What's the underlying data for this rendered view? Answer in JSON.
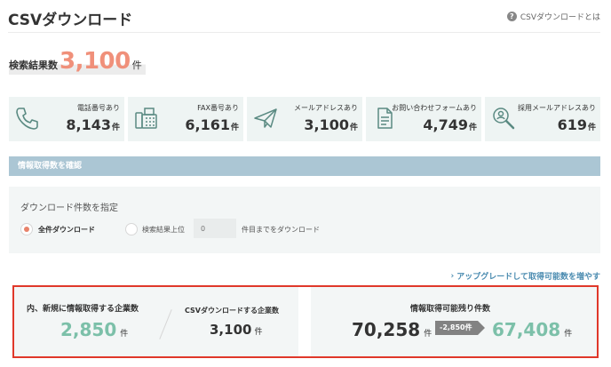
{
  "header": {
    "title": "CSVダウンロード",
    "help_icon": "?",
    "help_link": "CSVダウンロードとは"
  },
  "result": {
    "label": "検索結果数",
    "count": "3,100",
    "unit": "件"
  },
  "stats": [
    {
      "icon": "phone-icon",
      "label": "電話番号あり",
      "value": "8,143",
      "unit": "件"
    },
    {
      "icon": "fax-icon",
      "label": "FAX番号あり",
      "value": "6,161",
      "unit": "件"
    },
    {
      "icon": "paper-plane-icon",
      "label": "メールアドレスあり",
      "value": "3,100",
      "unit": "件"
    },
    {
      "icon": "document-icon",
      "label": "お問い合わせフォームあり",
      "value": "4,749",
      "unit": "件"
    },
    {
      "icon": "search-person-icon",
      "label": "採用メールアドレスあり",
      "value": "619",
      "unit": "件"
    }
  ],
  "section": {
    "title": "情報取得数を確認"
  },
  "download": {
    "title": "ダウンロード件数を指定",
    "option_all": "全件ダウンロード",
    "option_top_prefix": "検索結果上位",
    "top_placeholder": "0",
    "option_top_suffix": "件目までをダウンロード"
  },
  "upgrade": {
    "chevron": "›",
    "label": "アップグレードして取得可能数を増やす"
  },
  "summary": {
    "new_label": "内、新規に情報取得する企業数",
    "new_value": "2,850",
    "new_unit": "件",
    "csv_label": "CSVダウンロードする企業数",
    "csv_value": "3,100",
    "csv_unit": "件",
    "remaining_label": "情報取得可能残り件数",
    "remaining_before": "70,258",
    "remaining_before_unit": "件",
    "deduction": "-2,850件",
    "remaining_after": "67,408",
    "remaining_after_unit": "件"
  },
  "colors": {
    "accent_orange": "#f0907a",
    "accent_green": "#7cc0a9",
    "section_bar": "#abc6d4",
    "highlight_border": "#e0382a",
    "link_blue": "#4a8bb0"
  }
}
